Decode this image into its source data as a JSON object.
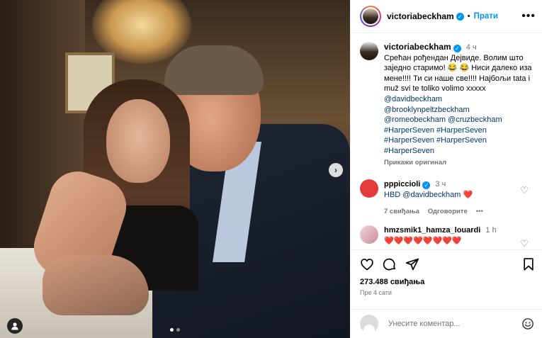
{
  "post": {
    "username": "victoriabeckham",
    "follow_label": "Прати",
    "separator": "•",
    "more_label": "•••"
  },
  "caption": {
    "username": "victoriabeckham",
    "time": "4 ч",
    "text": "Срећан рођендан Дејвиде. Волим што заједно старимо! 😂 😂 Ниси далеко иза мене!!!! Ти си наше све!!!! Најбољи tata i muž svi te toliko volimo xxxxx",
    "tags": [
      "@davidbeckham",
      "@brooklynpeltzbeckham",
      "@romeobeckham @cruzbeckham",
      "#HarperSeven #HarperSeven",
      "#HarperSeven #HarperSeven",
      "#HarperSeven"
    ],
    "translate_label": "Прикажи оригинал"
  },
  "comments": [
    {
      "username": "pppiccioli",
      "time": "3 ч",
      "mention": "HBD @davidbeckham",
      "emoji": "❤️",
      "likes": "7 свиђања",
      "reply_label": "Одговорите",
      "more": "•••"
    },
    {
      "username": "hmzsmik1_hamza_louardi",
      "time": "1 h",
      "text": "❤️❤️❤️❤️❤️❤️❤️❤️"
    }
  ],
  "stats": {
    "likes": "273.488 свиђања",
    "ago": "Пре 4 сати"
  },
  "comment_box": {
    "placeholder": "Унесите коментар..."
  },
  "carousel": {
    "next": "›"
  }
}
